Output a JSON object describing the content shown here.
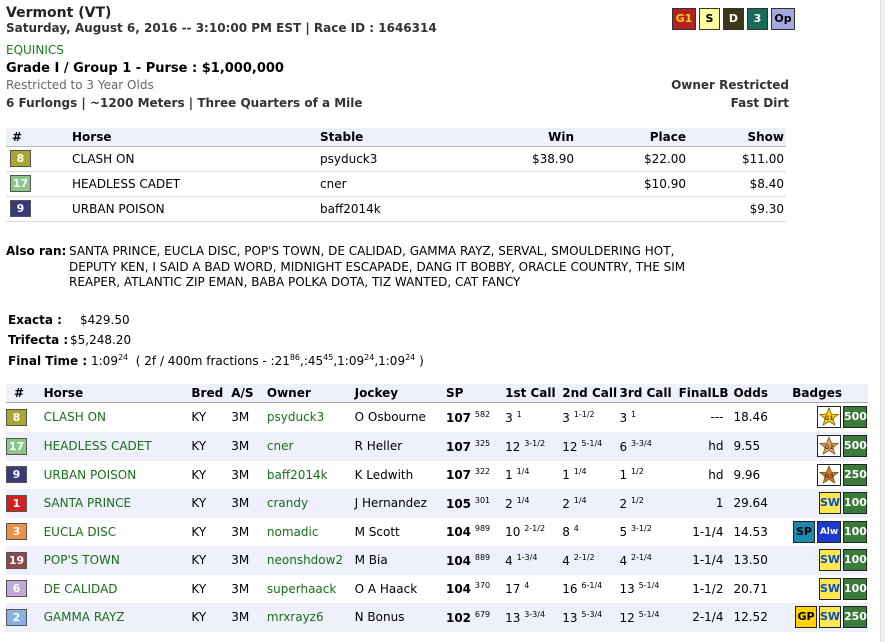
{
  "race": {
    "location": "Vermont (VT)",
    "datetime": "Saturday, August 6, 2016 -- 3:10:00 PM EST | Race ID : 1646314",
    "track": "EQUINICS",
    "grade": "Grade I / Group 1 - Purse : $1,000,000",
    "restriction": "Restricted to 3 Year Olds",
    "owner_restricted": "Owner Restricted",
    "distance": "6 Furlongs | ~1200 Meters | Three Quarters of a Mile",
    "surface": "Fast Dirt",
    "header_badges": [
      {
        "label": "G1",
        "bg": "#b22222",
        "fg": "#ffd400"
      },
      {
        "label": "S",
        "bg": "#ffffa0",
        "fg": "#000"
      },
      {
        "label": "D",
        "bg": "#3a3a1a",
        "fg": "#ffffff"
      },
      {
        "label": "3",
        "bg": "#1a6a5a",
        "fg": "#ffffff"
      },
      {
        "label": "Op",
        "bg": "#a8a8e0",
        "fg": "#000"
      }
    ]
  },
  "results_table": {
    "headers": {
      "num": "#",
      "horse": "Horse",
      "stable": "Stable",
      "win": "Win",
      "place": "Place",
      "show": "Show"
    },
    "rows": [
      {
        "num": "8",
        "color": "#a8a830",
        "horse": "CLASH ON",
        "stable": "psyduck3",
        "win": "$38.90",
        "place": "$22.00",
        "show": "$11.00"
      },
      {
        "num": "17",
        "color": "#8ac88a",
        "horse": "HEADLESS CADET",
        "stable": "cner",
        "win": "",
        "place": "$10.90",
        "show": "$8.40"
      },
      {
        "num": "9",
        "color": "#3a3a7a",
        "horse": "URBAN POISON",
        "stable": "baff2014k",
        "win": "",
        "place": "",
        "show": "$9.30"
      }
    ]
  },
  "also_ran": {
    "label": "Also ran:",
    "lines": [
      "SANTA PRINCE, EUCLA DISC, POP'S TOWN, DE CALIDAD, GAMMA RAYZ, SERVAL, SMOULDERING HOT,",
      "DEPUTY KEN, I SAID A BAD WORD, MIDNIGHT ESCAPADE, DANG IT BOBBY, ORACLE COUNTRY, THE SIM",
      "REAPER, ATLANTIC ZIP EMAN, BABA POLKA DOTA, TIZ WANTED, CAT FANCY"
    ]
  },
  "payouts": {
    "exacta_label": "Exacta :",
    "exacta_value": "$429.50",
    "trifecta_label": "Trifecta :",
    "trifecta_value": "$5,248.20",
    "final_time_label": "Final Time :",
    "final_time": "1:09",
    "final_time_sup": "24",
    "fractions_pre": "( 2f / 400m fractions - :21",
    "fractions_parts": [
      {
        "t": "86",
        "sup": true
      },
      {
        "t": ",:45",
        "sup": false
      },
      {
        "t": "45",
        "sup": true
      },
      {
        "t": ",1:09",
        "sup": false
      },
      {
        "t": "24",
        "sup": true
      },
      {
        "t": ",1:09",
        "sup": false
      },
      {
        "t": "24",
        "sup": true
      },
      {
        "t": " )",
        "sup": false
      }
    ]
  },
  "chart": {
    "headers": {
      "num": "#",
      "horse": "Horse",
      "bred": "Bred",
      "as": "A/S",
      "owner": "Owner",
      "jockey": "Jockey",
      "sp": "SP",
      "c1": "1st Call",
      "c2": "2nd Call",
      "c3": "3rd Call",
      "final": "FinalLB",
      "odds": "Odds",
      "badges": "Badges"
    },
    "rows": [
      {
        "num": "8",
        "color": "#a8a830",
        "horse": "CLASH ON",
        "bred": "KY",
        "as": "3M",
        "owner": "psyduck3",
        "jockey": "O Osbourne",
        "sp": "107",
        "sp_sup": "582",
        "c1": "3",
        "c1s": "1",
        "c2": "3",
        "c2s": "1-1/2",
        "c3": "3",
        "c3s": "1",
        "final": "---",
        "odds": "18.46",
        "badges": [
          {
            "type": "star",
            "label": "G1",
            "color": "#ffd400"
          },
          {
            "type": "num",
            "label": "500"
          }
        ]
      },
      {
        "num": "17",
        "color": "#8ac88a",
        "horse": "HEADLESS CADET",
        "bred": "KY",
        "as": "3M",
        "owner": "cner",
        "jockey": "R Heller",
        "sp": "107",
        "sp_sup": "325",
        "c1": "12",
        "c1s": "3-1/2",
        "c2": "12",
        "c2s": "5-1/4",
        "c3": "6",
        "c3s": "3-3/4",
        "final": "hd",
        "odds": "9.55",
        "badges": [
          {
            "type": "star",
            "label": "G2",
            "color": "#e0a070"
          },
          {
            "type": "num",
            "label": "500"
          }
        ]
      },
      {
        "num": "9",
        "color": "#3a3a7a",
        "horse": "URBAN POISON",
        "bred": "KY",
        "as": "3M",
        "owner": "baff2014k",
        "jockey": "K Ledwith",
        "sp": "107",
        "sp_sup": "322",
        "c1": "1",
        "c1s": "1/4",
        "c2": "1",
        "c2s": "1/4",
        "c3": "1",
        "c3s": "1/2",
        "final": "hd",
        "odds": "9.96",
        "badges": [
          {
            "type": "star",
            "label": "G3",
            "color": "#c87840"
          },
          {
            "type": "num",
            "label": "250"
          }
        ]
      },
      {
        "num": "1",
        "color": "#d02020",
        "horse": "SANTA PRINCE",
        "bred": "KY",
        "as": "3M",
        "owner": "crandy",
        "jockey": "J Hernandez",
        "sp": "105",
        "sp_sup": "301",
        "c1": "2",
        "c1s": "1/4",
        "c2": "2",
        "c2s": "1/4",
        "c3": "2",
        "c3s": "1/2",
        "final": "1",
        "odds": "29.64",
        "badges": [
          {
            "type": "sw",
            "label": "SW"
          },
          {
            "type": "num",
            "label": "100"
          }
        ]
      },
      {
        "num": "3",
        "color": "#f09040",
        "horse": "EUCLA DISC",
        "bred": "KY",
        "as": "3M",
        "owner": "nomadic",
        "jockey": "M Scott",
        "sp": "104",
        "sp_sup": "989",
        "c1": "10",
        "c1s": "2-1/2",
        "c2": "8",
        "c2s": "4",
        "c3": "5",
        "c3s": "3-1/2",
        "final": "1-1/4",
        "odds": "14.53",
        "badges": [
          {
            "type": "sp",
            "label": "SP"
          },
          {
            "type": "alw",
            "label": "Alw"
          },
          {
            "type": "num",
            "label": "100"
          }
        ]
      },
      {
        "num": "19",
        "color": "#8a4a4a",
        "horse": "POP'S TOWN",
        "bred": "KY",
        "as": "3M",
        "owner": "neonshdow2",
        "jockey": "M Bia",
        "sp": "104",
        "sp_sup": "889",
        "c1": "4",
        "c1s": "1-3/4",
        "c2": "4",
        "c2s": "2-1/2",
        "c3": "4",
        "c3s": "2-1/4",
        "final": "1-1/4",
        "odds": "13.50",
        "badges": [
          {
            "type": "sw",
            "label": "SW"
          },
          {
            "type": "num",
            "label": "100"
          }
        ]
      },
      {
        "num": "6",
        "color": "#c0a8d8",
        "horse": "DE CALIDAD",
        "bred": "KY",
        "as": "3M",
        "owner": "superhaack",
        "jockey": "O A Haack",
        "sp": "104",
        "sp_sup": "370",
        "c1": "17",
        "c1s": "4",
        "c2": "16",
        "c2s": "6-1/4",
        "c3": "13",
        "c3s": "5-1/4",
        "final": "1-1/2",
        "odds": "20.71",
        "badges": [
          {
            "type": "sw",
            "label": "SW"
          },
          {
            "type": "num",
            "label": "100"
          }
        ]
      },
      {
        "num": "2",
        "color": "#8ab0e0",
        "horse": "GAMMA RAYZ",
        "bred": "KY",
        "as": "3M",
        "owner": "mrxrayz6",
        "jockey": "N Bonus",
        "sp": "102",
        "sp_sup": "679",
        "c1": "13",
        "c1s": "3-3/4",
        "c2": "13",
        "c2s": "5-3/4",
        "c3": "12",
        "c3s": "5-1/4",
        "final": "2-1/4",
        "odds": "12.52",
        "badges": [
          {
            "type": "gp",
            "label": "GP"
          },
          {
            "type": "sw",
            "label": "SW"
          },
          {
            "type": "num",
            "label": "250"
          }
        ]
      }
    ]
  }
}
